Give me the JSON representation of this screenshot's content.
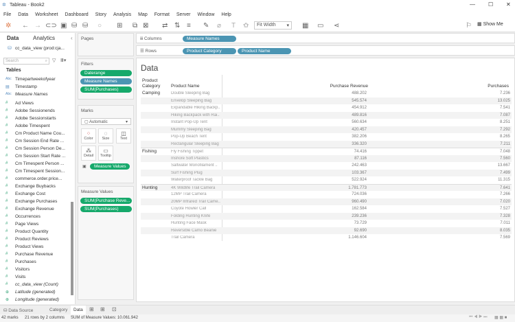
{
  "window": {
    "title": "Tableau - Book2"
  },
  "menu": [
    "File",
    "Data",
    "Worksheet",
    "Dashboard",
    "Story",
    "Analysis",
    "Map",
    "Format",
    "Server",
    "Window",
    "Help"
  ],
  "toolbar": {
    "fit": "Fit Width",
    "show_me": "Show Me"
  },
  "left_pane": {
    "tab_data": "Data",
    "tab_analytics": "Analytics",
    "datasource": "cc_data_view (prod:cja...",
    "search_placeholder": "Search",
    "tables_heading": "Tables",
    "fields": [
      {
        "name": "Timepartweekofyear",
        "type": "abc"
      },
      {
        "name": "Timestamp",
        "type": "date"
      },
      {
        "name": "Measure Names",
        "type": "abc",
        "italic": true
      },
      {
        "name": "Ad Views",
        "type": "num"
      },
      {
        "name": "Adobe Sessionends",
        "type": "num"
      },
      {
        "name": "Adobe Sessionstarts",
        "type": "num"
      },
      {
        "name": "Adobe Timespent",
        "type": "num"
      },
      {
        "name": "Cm Product Name Cou...",
        "type": "num"
      },
      {
        "name": "Cm Session End Rate ...",
        "type": "num"
      },
      {
        "name": "Cm Session Person De...",
        "type": "num"
      },
      {
        "name": "Cm Session Start Rate ...",
        "type": "num"
      },
      {
        "name": "Cm Timespent Person ...",
        "type": "num"
      },
      {
        "name": "Cm Timespent Session...",
        "type": "num"
      },
      {
        "name": "commerce.order.price...",
        "type": "num"
      },
      {
        "name": "Exchange Buybacks",
        "type": "num"
      },
      {
        "name": "Exchange Cost",
        "type": "num"
      },
      {
        "name": "Exchange Purchases",
        "type": "num"
      },
      {
        "name": "Exchange Revenue",
        "type": "num"
      },
      {
        "name": "Occurrences",
        "type": "num"
      },
      {
        "name": "Page Views",
        "type": "num"
      },
      {
        "name": "Product Quantity",
        "type": "num"
      },
      {
        "name": "Product Reviews",
        "type": "num"
      },
      {
        "name": "Product Views",
        "type": "num"
      },
      {
        "name": "Purchase Revenue",
        "type": "num"
      },
      {
        "name": "Purchases",
        "type": "num"
      },
      {
        "name": "Visitors",
        "type": "num"
      },
      {
        "name": "Visits",
        "type": "num"
      },
      {
        "name": "cc_data_view (Count)",
        "type": "num",
        "italic": true
      },
      {
        "name": "Latitude (generated)",
        "type": "geo",
        "italic": true
      },
      {
        "name": "Longitude (generated)",
        "type": "geo",
        "italic": true
      }
    ]
  },
  "cards": {
    "pages": "Pages",
    "filters": "Filters",
    "filter_pills": [
      "Daterange",
      "Measure Names",
      "SUM(Purchases)"
    ],
    "marks": "Marks",
    "mark_type": "Automatic",
    "mark_buttons": [
      "Color",
      "Size",
      "Text",
      "Detail",
      "Tooltip"
    ],
    "marks_pill": "Measure Values",
    "measure_values": "Measure Values",
    "mv_pills": [
      "SUM(Purchase Reve...",
      "SUM(Purchases)"
    ]
  },
  "shelves": {
    "columns_label": "Columns",
    "columns_pills": [
      "Measure Names"
    ],
    "rows_label": "Rows",
    "rows_pills": [
      "Product Category",
      "Product Name"
    ]
  },
  "view": {
    "title": "Data",
    "headers": {
      "category": "Product Category",
      "name": "Product Name",
      "revenue": "Purchase Revenue",
      "purchases": "Purchases"
    },
    "rows": [
      {
        "category": "Camping",
        "name": "Double Sleeping Bag",
        "revenue": "488.202",
        "purchases": "7.236"
      },
      {
        "category": "",
        "name": "Envelop Sleeping Bag",
        "revenue": "545.574",
        "purchases": "13.025"
      },
      {
        "category": "",
        "name": "Expandable Hiking Backp..",
        "revenue": "454.912",
        "purchases": "7.541"
      },
      {
        "category": "",
        "name": "Hiking Backpack with Rai..",
        "revenue": "489.816",
        "purchases": "7.087"
      },
      {
        "category": "",
        "name": "Instant Pop-Up Tent",
        "revenue": "560.634",
        "purchases": "8.251"
      },
      {
        "category": "",
        "name": "Mummy Sleeping Bag",
        "revenue": "420.457",
        "purchases": "7.292"
      },
      {
        "category": "",
        "name": "Pop-Up Beach Tent",
        "revenue": "382.206",
        "purchases": "8.265"
      },
      {
        "category": "",
        "name": "Rectangular Sleeping Bag",
        "revenue": "336.320",
        "purchases": "7.211"
      },
      {
        "category": "Fishing",
        "name": "Fly Fishing Tippet",
        "revenue": "74.416",
        "purchases": "7.048"
      },
      {
        "category": "",
        "name": "Inshore Soft Plastics",
        "revenue": "87.116",
        "purchases": "7.560"
      },
      {
        "category": "",
        "name": "Saltwater Monofilament ..",
        "revenue": "242.463",
        "purchases": "13.667"
      },
      {
        "category": "",
        "name": "Surf Fishing Plug",
        "revenue": "103.367",
        "purchases": "7.499"
      },
      {
        "category": "",
        "name": "Waterproof Tackle Bag",
        "revenue": "522.924",
        "purchases": "11.315"
      },
      {
        "category": "Hunting",
        "name": "4K Wildlife Trail Camera",
        "revenue": "1.781.773",
        "purchases": "7.641"
      },
      {
        "category": "",
        "name": "12MP Trail Camera",
        "revenue": "724.036",
        "purchases": "7.266"
      },
      {
        "category": "",
        "name": "20MP Infrared Trail Came..",
        "revenue": "960.490",
        "purchases": "7.020"
      },
      {
        "category": "",
        "name": "Coyote Howler Call",
        "revenue": "162.584",
        "purchases": "7.527"
      },
      {
        "category": "",
        "name": "Folding Hunting Knife",
        "revenue": "239.236",
        "purchases": "7.328"
      },
      {
        "category": "",
        "name": "Hunting Face Mask",
        "revenue": "73.729",
        "purchases": "7.011"
      },
      {
        "category": "",
        "name": "Reversible Camo Beanie",
        "revenue": "92.690",
        "purchases": "8.035"
      },
      {
        "category": "",
        "name": "Trail Camera",
        "revenue": "1.146.604",
        "purchases": "7.569"
      }
    ]
  },
  "bottom_tabs": {
    "datasource": "Data Source",
    "sheets": [
      "Category",
      "Data"
    ]
  },
  "status": {
    "marks": "42 marks",
    "dims": "21 rows by 2 columns",
    "sum": "SUM of Measure Values: 10.061.942"
  }
}
